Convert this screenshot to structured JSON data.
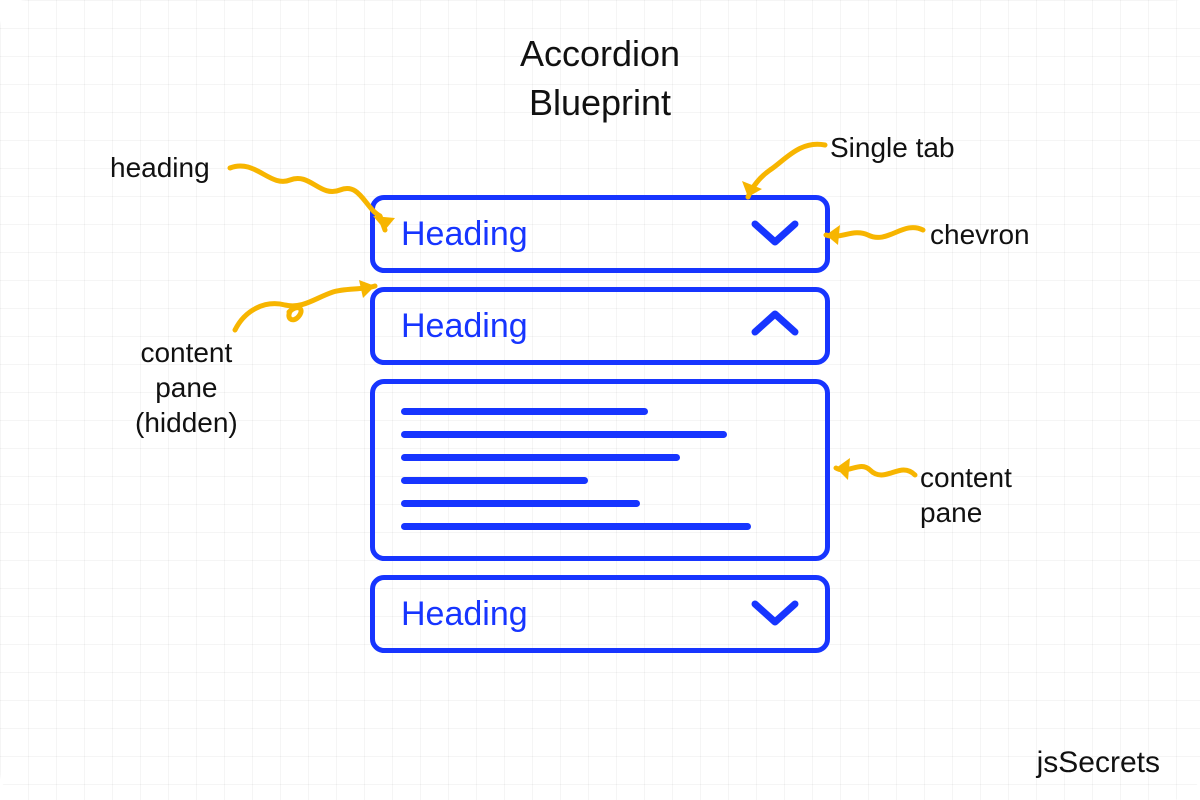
{
  "title": "Accordion\nBlueprint",
  "tabs": [
    {
      "heading": "Heading",
      "chevron": "down"
    },
    {
      "heading": "Heading",
      "chevron": "up"
    },
    {
      "heading": "Heading",
      "chevron": "down"
    }
  ],
  "annotations": {
    "heading": "heading",
    "single_tab": "Single tab",
    "chevron": "chevron",
    "content_pane_hidden": "content\npane\n(hidden)",
    "content_pane": "content\npane"
  },
  "attribution": "jsSecrets",
  "colors": {
    "accent": "#1735ff",
    "arrow": "#f7b500",
    "text": "#111111"
  }
}
